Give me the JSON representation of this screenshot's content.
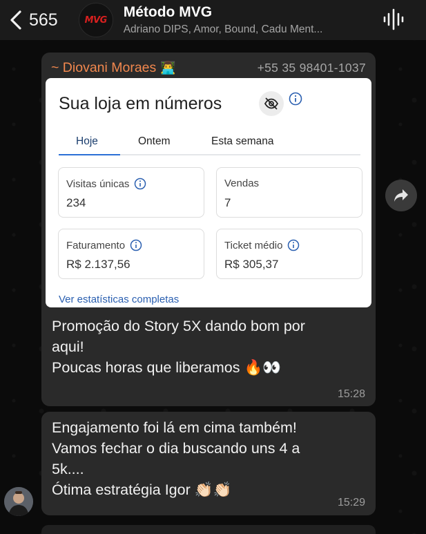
{
  "header": {
    "back_count": "565",
    "group_avatar_text": "MVG",
    "group_name": "Método MVG",
    "members": "Adriano DIPS, Amor, Bound, Cadu Ment..."
  },
  "message1": {
    "sender_name": "~ Diovani Moraes",
    "sender_emoji": "👨‍💻",
    "sender_phone": "+55 35 98401-1037",
    "card": {
      "title": "Sua loja em números",
      "tabs": [
        {
          "label": "Hoje",
          "active": true
        },
        {
          "label": "Ontem",
          "active": false
        },
        {
          "label": "Esta semana",
          "active": false
        }
      ],
      "stats": [
        {
          "label": "Visitas únicas",
          "value": "234",
          "has_info": true
        },
        {
          "label": "Vendas",
          "value": "7",
          "has_info": false
        },
        {
          "label": "Faturamento",
          "value": "R$ 2.137,56",
          "has_info": true
        },
        {
          "label": "Ticket médio",
          "value": "R$ 305,37",
          "has_info": true
        }
      ],
      "link": "Ver estatísticas completas"
    },
    "text_lines": [
      "Promoção do Story 5X dando bom por",
      "aqui!",
      "Poucas horas que liberamos 🔥👀"
    ],
    "time": "15:28"
  },
  "message2": {
    "text_lines": [
      "Engajamento foi lá em cima também!",
      "Vamos fechar o dia buscando uns 4 a",
      "5k....",
      "Ótima estratégia Igor 👏🏻👏🏻"
    ],
    "time": "15:29"
  },
  "icons": {
    "back": "chevron-left-icon",
    "voice": "voice-waveform-icon",
    "eye": "eye-slash-icon",
    "info": "info-icon",
    "forward": "forward-arrow-icon"
  },
  "colors": {
    "sender_name": "#f2884e",
    "link": "#2a5fb0",
    "active_tab_underline": "#2a6fd6",
    "bubble": "#2a2a2a"
  }
}
